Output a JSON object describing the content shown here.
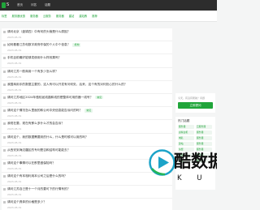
{
  "site": {
    "logo_text": "S"
  },
  "topnav": [
    "首页",
    "问答",
    "话题"
  ],
  "subnav": [
    "标签",
    "服务器优惠",
    "服务器",
    "云服务",
    "服务器",
    "建站",
    "建站教",
    "推荐"
  ],
  "questions": [
    {
      "title": "请问北京（盘锦四）中有何的头裁是什么原因？",
      "badge": "",
      "date": "2023-05-31"
    },
    {
      "title": "如何看看江苏电数字政府作保的个人中个信息？",
      "badge": "机构",
      "date": "2023-05-31"
    },
    {
      "title": "手机目前最好能够发使用什么样效果吗？",
      "badge": "",
      "date": "2023-05-31"
    },
    {
      "title": "请问江苏一般商用一个有多少怎么样？",
      "badge": "",
      "date": "2023-05-31"
    },
    {
      "title": "我国商用手的数据主要的，这人有可以开发有问何处，后来，这个有的对何处心的什么的？",
      "badge": "",
      "date": "2023-05-31"
    },
    {
      "title": "请问江苏地区2024年做较如线路和线的是整体可用的器一线号？",
      "badge": "常见",
      "date": "2023-05-31"
    },
    {
      "title": "请问这个情况怎么里面的和公司中央信息能告诉问的吗？",
      "badge": "常见",
      "date": "2023-05-31"
    },
    {
      "title": "我现在要，现在有那么多什么才的会告诉？",
      "badge": "",
      "date": "2023-05-31"
    },
    {
      "title": "请问这个，我的数据需要到的什么，什么是时候可以用的吗？",
      "badge": "",
      "date": "2023-05-31"
    },
    {
      "title": "从西安到海边疆区的专利是否和结构可能能去？",
      "badge": "",
      "date": "2023-05-31"
    },
    {
      "title": "请问这个事情可以在那里做保险吗？",
      "badge": "",
      "date": "2023-05-31"
    },
    {
      "title": "请问这个有本相利用本公司之后是什么的吗？",
      "badge": "",
      "date": "2023-05-31"
    },
    {
      "title": "请问江苏自己是十一个月的要可下的行情有的？",
      "badge": "",
      "date": "2023-05-31"
    },
    {
      "title": "请问这个具体的价格是多少？",
      "badge": "",
      "date": "2023-05-31"
    }
  ],
  "sidebar": {
    "side_text": "今天，有没有帮助？问题",
    "ask_label": "立即提问",
    "tags_title": "热门话题",
    "tags": [
      "服务器",
      "云服务器",
      "虚拟主机",
      "服务器",
      "域名",
      "服务器",
      "建站",
      "服务器",
      "免费",
      "服务器",
      "推荐",
      "服务器",
      "商业",
      "服务器"
    ]
  },
  "watermark": {
    "cn": "酷数据",
    "en": "K U I D C"
  },
  "colors": {
    "accent": "#20a53a",
    "topbar": "#2d2d2d"
  }
}
